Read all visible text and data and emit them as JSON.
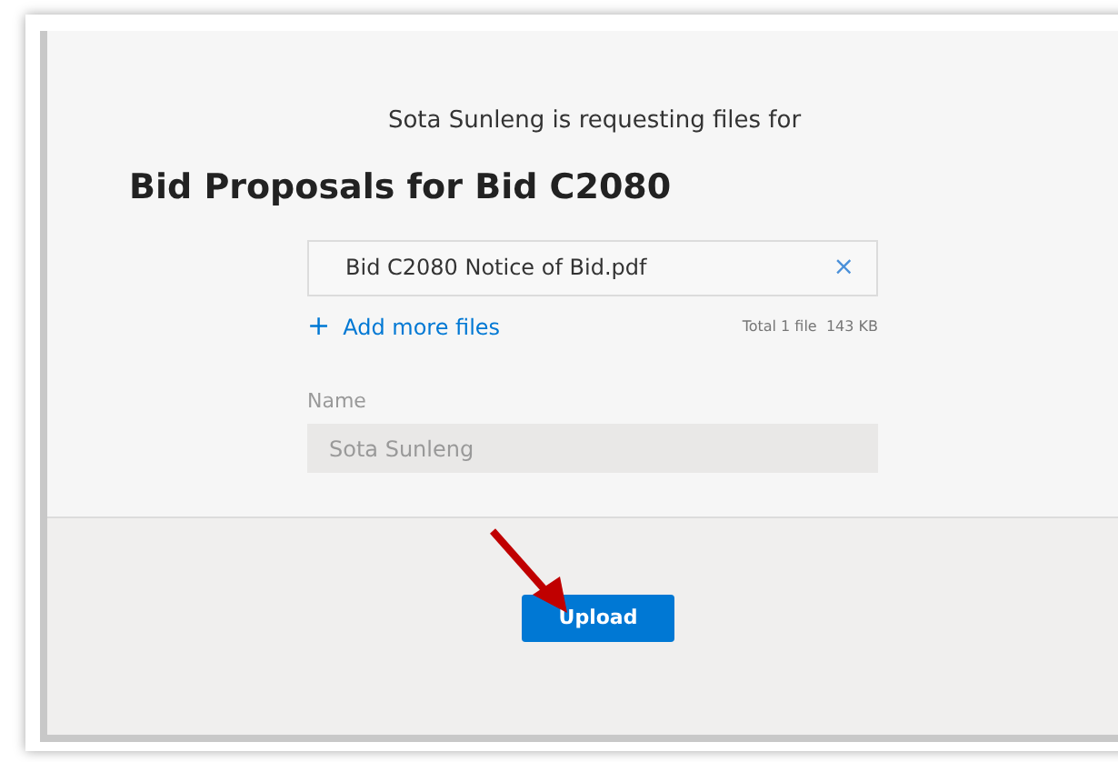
{
  "request": {
    "subtitle": "Sota Sunleng is requesting files for",
    "title": "Bid Proposals for Bid C2080"
  },
  "files": [
    {
      "name": "Bid C2080 Notice of Bid.pdf",
      "remove": "×"
    }
  ],
  "add_more": {
    "icon": "+",
    "label": "Add more files"
  },
  "total": {
    "count": "Total 1 file",
    "size": "143 KB"
  },
  "name_field": {
    "label": "Name",
    "value": "Sota Sunleng",
    "disabled": true
  },
  "upload_button": {
    "label": "Upload"
  }
}
